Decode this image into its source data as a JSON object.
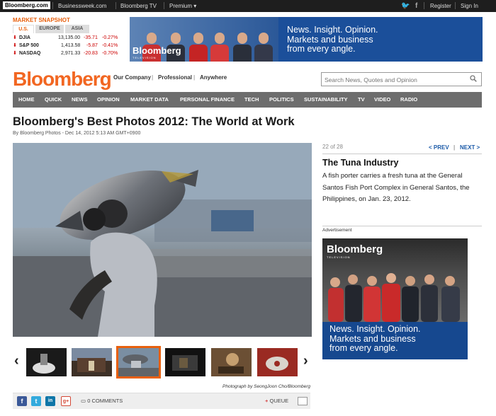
{
  "topbar": {
    "links": [
      "Bloomberg.com",
      "Businessweek.com",
      "Bloomberg TV",
      "Premium"
    ],
    "register": "Register",
    "signin": "Sign In"
  },
  "market": {
    "title": "MARKET SNAPSHOT",
    "tabs": [
      "U.S.",
      "EUROPE",
      "ASIA"
    ],
    "rows": [
      {
        "name": "DJIA",
        "value": "13,135.00",
        "change": "-35.71",
        "pct": "-0.27%"
      },
      {
        "name": "S&P 500",
        "value": "1,413.58",
        "change": "-5.87",
        "pct": "-0.41%"
      },
      {
        "name": "NASDAQ",
        "value": "2,971.33",
        "change": "-20.83",
        "pct": "-0.70%"
      }
    ]
  },
  "banner": {
    "brand": "Bloomberg",
    "brand_sub": "TELEVISION",
    "tagline": [
      "News. Insight. Opinion.",
      "Markets and business",
      "from every angle."
    ]
  },
  "logo": "Bloomberg",
  "sublinks": [
    "Our Company",
    "Professional",
    "Anywhere"
  ],
  "search": {
    "placeholder": "Search News, Quotes and Opinion"
  },
  "nav": [
    "HOME",
    "QUICK",
    "NEWS",
    "OPINION",
    "MARKET DATA",
    "PERSONAL FINANCE",
    "TECH",
    "POLITICS",
    "SUSTAINABILITY",
    "TV",
    "VIDEO",
    "RADIO"
  ],
  "article": {
    "headline": "Bloomberg's Best Photos 2012: The World at Work",
    "byline": "By Bloomberg Photos - Dec 14, 2012 5:13 AM GMT+0900",
    "credit": "Photograph by SeongJoon Cho/Bloomberg",
    "comments": "0 COMMENTS",
    "queue": "QUEUE"
  },
  "gallery": {
    "counter": "22 of 28",
    "prev": "< PREV",
    "next": "NEXT >",
    "caption_title": "The Tuna Industry",
    "caption": "A fish porter carries a fresh tuna at the General Santos Fish Port Complex in General Santos, the Philippines, on Jan. 23, 2012.",
    "thumbs_count_visible": 6,
    "selected_thumb": 3
  },
  "ad": {
    "label": "Advertisement",
    "brand": "Bloomberg",
    "brand_sub": "TELEVISION",
    "tagline": [
      "News. Insight. Opinion.",
      "Markets and business",
      "from every angle."
    ]
  },
  "colors": {
    "brand_orange": "#f26722",
    "nav_grey": "#6d6d6d",
    "link_blue": "#1b5aa8",
    "down_red": "#cc0000"
  }
}
